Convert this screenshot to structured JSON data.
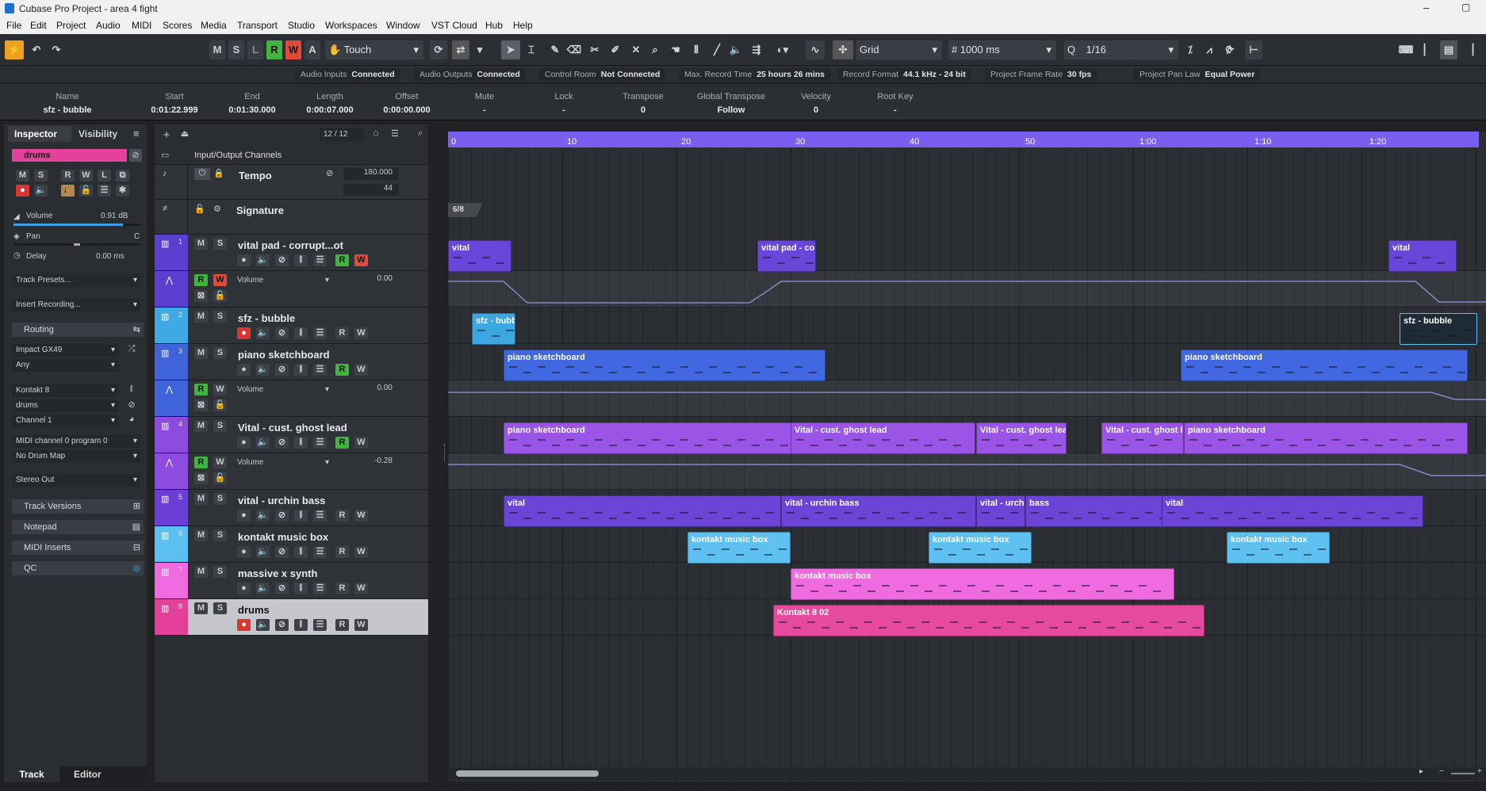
{
  "window": {
    "title": "Cubase Pro Project - area 4 fight"
  },
  "menu": [
    "File",
    "Edit",
    "Project",
    "Audio",
    "MIDI",
    "Scores",
    "Media",
    "Transport",
    "Studio",
    "Workspaces",
    "Window",
    "VST Cloud",
    "Hub",
    "Help"
  ],
  "toolbar": {
    "m": "M",
    "s": "S",
    "l": "L",
    "r": "R",
    "w": "W",
    "a": "A",
    "automation_mode": "Touch",
    "snap": "Grid",
    "grid_value": "1000 ms",
    "quantize": "1/16"
  },
  "status": [
    {
      "label": "Audio Inputs",
      "value": "Connected"
    },
    {
      "label": "Audio Outputs",
      "value": "Connected"
    },
    {
      "label": "Control Room",
      "value": "Not Connected"
    },
    {
      "label": "Max. Record Time",
      "value": "25 hours 26 mins"
    },
    {
      "label": "Record Format",
      "value": "44.1 kHz - 24 bit"
    },
    {
      "label": "Project Frame Rate",
      "value": "30 fps"
    },
    {
      "label": "Project Pan Law",
      "value": "Equal Power"
    }
  ],
  "info": [
    {
      "label": "Name",
      "value": "sfz - bubble"
    },
    {
      "label": "Start",
      "value": "0:01:22.999"
    },
    {
      "label": "End",
      "value": "0:01:30.000"
    },
    {
      "label": "Length",
      "value": "0:00:07.000"
    },
    {
      "label": "Offset",
      "value": "0:00:00.000"
    },
    {
      "label": "Mute",
      "value": "-"
    },
    {
      "label": "Lock",
      "value": "-"
    },
    {
      "label": "Transpose",
      "value": "0"
    },
    {
      "label": "Global Transpose",
      "value": "Follow"
    },
    {
      "label": "Velocity",
      "value": "0"
    },
    {
      "label": "Root Key",
      "value": "-"
    }
  ],
  "inspector": {
    "tab_inspector": "Inspector",
    "tab_visibility": "Visibility",
    "track_name": "drums",
    "volume_label": "Volume",
    "volume_value": "0.91 dB",
    "pan_label": "Pan",
    "pan_value": "C",
    "delay_label": "Delay",
    "delay_value": "0.00 ms",
    "track_presets": "Track Presets...",
    "insert_recording": "Insert Recording...",
    "routing": "Routing",
    "input": "Impact GX49",
    "channel_in": "Any",
    "instrument": "Kontakt 8",
    "output_track": "drums",
    "channel": "Channel 1",
    "program": "MIDI channel 0 program 0",
    "drum_map": "No Drum Map",
    "stereo_out": "Stereo Out",
    "track_versions": "Track Versions",
    "notepad": "Notepad",
    "midi_inserts": "MIDI Inserts",
    "qc": "QC",
    "bottom_track": "Track",
    "bottom_editor": "Editor"
  },
  "tracklist": {
    "counter": "12 / 12",
    "io_channels": "Input/Output Channels",
    "tempo_label": "Tempo",
    "tempo_value": "180.000",
    "tempo_sub": "44",
    "signature_label": "Signature",
    "signature_value": "6/8",
    "tracks": [
      {
        "num": "1",
        "name": "vital pad - corrupt...ot",
        "color": "#5a3fd0",
        "auto": {
          "param": "Volume",
          "value": "0.00"
        }
      },
      {
        "num": "2",
        "name": "sfz - bubble",
        "color": "#3fa9e6"
      },
      {
        "num": "3",
        "name": "piano sketchboard",
        "color": "#3f63d8",
        "auto": {
          "param": "Volume",
          "value": "0.00"
        }
      },
      {
        "num": "4",
        "name": "Vital - cust. ghost lead",
        "color": "#8d4be0",
        "auto": {
          "param": "Volume",
          "value": "-0.28"
        }
      },
      {
        "num": "5",
        "name": "vital - urchin bass",
        "color": "#6b3fd6"
      },
      {
        "num": "6",
        "name": "kontakt music box",
        "color": "#5bc0f0"
      },
      {
        "num": "7",
        "name": "massive x synth",
        "color": "#f06adf"
      },
      {
        "num": "8",
        "name": "drums",
        "color": "#e2409a"
      }
    ]
  },
  "ruler": [
    "0",
    "10",
    "20",
    "30",
    "40",
    "50",
    "1:00",
    "1:10",
    "1:20"
  ],
  "events": [
    {
      "label": "vital",
      "color": "#6846d9"
    },
    {
      "label": "vital pad - cor",
      "color": "#6846d9"
    },
    {
      "label": "vital",
      "color": "#6846d9"
    },
    {
      "label": "sfz - bubb",
      "color": "#3da6e0"
    },
    {
      "label": "sfz - bubble",
      "color": "#1e2a36"
    },
    {
      "label": "piano sketchboard",
      "color": "#4168e0"
    },
    {
      "label": "piano sketchboard",
      "color": "#4168e0"
    },
    {
      "label": "piano sketchboard",
      "color": "#9b55e6"
    },
    {
      "label": "Vital - cust. ghost lead",
      "color": "#9b55e6"
    },
    {
      "label": "Vital - cust. ghost lea",
      "color": "#9b55e6"
    },
    {
      "label": "Vital - cust. ghost l",
      "color": "#9b55e6"
    },
    {
      "label": "piano sketchboard",
      "color": "#9b55e6"
    },
    {
      "label": "vital",
      "color": "#6b44d6"
    },
    {
      "label": "vital - urchin bass",
      "color": "#6b44d6"
    },
    {
      "label": "vital - urch",
      "color": "#6b44d6"
    },
    {
      "label": "bass",
      "color": "#6b44d6"
    },
    {
      "label": "vital",
      "color": "#6b44d6"
    },
    {
      "label": "kontakt music box",
      "color": "#5ec1f1"
    },
    {
      "label": "kontakt music box",
      "color": "#5ec1f1"
    },
    {
      "label": "kontakt music box",
      "color": "#5ec1f1"
    },
    {
      "label": "kontakt music box",
      "color": "#f06ae0"
    },
    {
      "label": "Kontakt 8 02",
      "color": "#e64a9c"
    }
  ]
}
